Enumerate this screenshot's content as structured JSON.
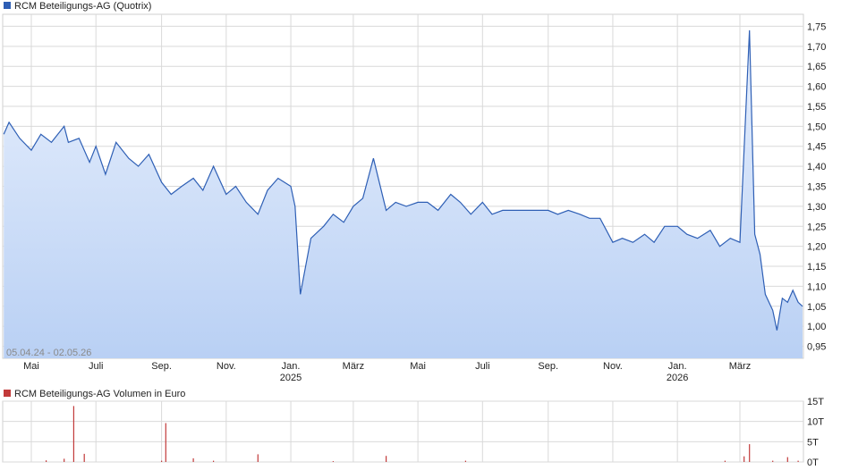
{
  "colors": {
    "price_line": "#2e5fb5",
    "price_fill_top": "#e8f0fd",
    "price_fill_bottom": "#b9d0f4",
    "volume_bar": "#c23a3a",
    "grid": "#d9d9d9",
    "legend_price": "#2e5fb5",
    "legend_volume": "#c23a3a"
  },
  "chart_data": [
    {
      "type": "area",
      "title": "RCM Beteiligungs-AG (Quotrix)",
      "date_range": "05.04.24 - 02.05.26",
      "ylim": [
        0.92,
        1.78
      ],
      "y_ticks": [
        "0,95",
        "1,00",
        "1,05",
        "1,10",
        "1,15",
        "1,20",
        "1,25",
        "1,30",
        "1,35",
        "1,40",
        "1,45",
        "1,50",
        "1,55",
        "1,60",
        "1,65",
        "1,70",
        "1,75"
      ],
      "x_ticks": [
        {
          "label": "Mai",
          "sublabel": ""
        },
        {
          "label": "Juli",
          "sublabel": ""
        },
        {
          "label": "Sep.",
          "sublabel": ""
        },
        {
          "label": "Nov.",
          "sublabel": ""
        },
        {
          "label": "Jan.",
          "sublabel": "2025"
        },
        {
          "label": "März",
          "sublabel": ""
        },
        {
          "label": "Mai",
          "sublabel": ""
        },
        {
          "label": "Juli",
          "sublabel": ""
        },
        {
          "label": "Sep.",
          "sublabel": ""
        },
        {
          "label": "Nov.",
          "sublabel": ""
        },
        {
          "label": "Jan.",
          "sublabel": "2026"
        },
        {
          "label": "März",
          "sublabel": ""
        }
      ],
      "series": [
        {
          "x": [
            "2024-04-05",
            "2024-04-10",
            "2024-04-20",
            "2024-05-01",
            "2024-05-10",
            "2024-05-20",
            "2024-06-01",
            "2024-06-05",
            "2024-06-15",
            "2024-06-25",
            "2024-07-01",
            "2024-07-10",
            "2024-07-20",
            "2024-08-01",
            "2024-08-10",
            "2024-08-20",
            "2024-09-01",
            "2024-09-10",
            "2024-09-20",
            "2024-10-01",
            "2024-10-10",
            "2024-10-20",
            "2024-11-01",
            "2024-11-10",
            "2024-11-20",
            "2024-12-01",
            "2024-12-10",
            "2024-12-20",
            "2025-01-01",
            "2025-01-05",
            "2025-01-10",
            "2025-01-20",
            "2025-02-01",
            "2025-02-10",
            "2025-02-20",
            "2025-03-01",
            "2025-03-10",
            "2025-03-20",
            "2025-04-01",
            "2025-04-10",
            "2025-04-20",
            "2025-05-01",
            "2025-05-10",
            "2025-05-20",
            "2025-06-01",
            "2025-06-10",
            "2025-06-20",
            "2025-07-01",
            "2025-07-10",
            "2025-07-20",
            "2025-08-01",
            "2025-08-10",
            "2025-08-20",
            "2025-09-01",
            "2025-09-10",
            "2025-09-20",
            "2025-10-01",
            "2025-10-10",
            "2025-10-20",
            "2025-11-01",
            "2025-11-10",
            "2025-11-20",
            "2025-12-01",
            "2025-12-10",
            "2025-12-20",
            "2026-01-01",
            "2026-01-10",
            "2026-01-20",
            "2026-02-01",
            "2026-02-10",
            "2026-02-20",
            "2026-03-01",
            "2026-03-10",
            "2026-03-15",
            "2026-03-20",
            "2026-03-25",
            "2026-04-01",
            "2026-04-05",
            "2026-04-10",
            "2026-04-15",
            "2026-04-20",
            "2026-04-25",
            "2026-05-02"
          ],
          "values": [
            1.48,
            1.51,
            1.47,
            1.44,
            1.48,
            1.46,
            1.5,
            1.46,
            1.47,
            1.41,
            1.45,
            1.38,
            1.46,
            1.42,
            1.4,
            1.43,
            1.36,
            1.33,
            1.35,
            1.37,
            1.34,
            1.4,
            1.33,
            1.35,
            1.31,
            1.28,
            1.34,
            1.37,
            1.35,
            1.3,
            1.08,
            1.22,
            1.25,
            1.28,
            1.26,
            1.3,
            1.32,
            1.42,
            1.29,
            1.31,
            1.3,
            1.31,
            1.31,
            1.29,
            1.33,
            1.31,
            1.28,
            1.31,
            1.28,
            1.29,
            1.29,
            1.29,
            1.29,
            1.29,
            1.28,
            1.29,
            1.28,
            1.27,
            1.27,
            1.21,
            1.22,
            1.21,
            1.23,
            1.21,
            1.25,
            1.25,
            1.23,
            1.22,
            1.24,
            1.2,
            1.22,
            1.21,
            1.74,
            1.23,
            1.18,
            1.08,
            1.04,
            0.99,
            1.07,
            1.06,
            1.09,
            1.06,
            1.05
          ]
        }
      ]
    },
    {
      "type": "bar",
      "title": "RCM Beteiligungs-AG Volumen in Euro",
      "ylim": [
        0,
        15
      ],
      "y_ticks": [
        "0T",
        "5T",
        "10T",
        "15T"
      ],
      "series": [
        {
          "x": [
            "2024-05-15",
            "2024-06-01",
            "2024-06-10",
            "2024-06-20",
            "2024-09-01",
            "2024-09-05",
            "2024-10-01",
            "2024-10-20",
            "2024-12-01",
            "2025-02-10",
            "2025-04-01",
            "2025-06-15",
            "2026-02-15",
            "2026-03-05",
            "2026-03-10",
            "2026-04-01",
            "2026-04-15",
            "2026-04-25"
          ],
          "values": [
            0.4,
            0.8,
            13.8,
            2.0,
            0.3,
            9.6,
            0.9,
            0.3,
            1.9,
            0.2,
            1.5,
            0.3,
            0.3,
            1.4,
            4.4,
            0.3,
            1.2,
            0.3
          ]
        }
      ]
    }
  ]
}
